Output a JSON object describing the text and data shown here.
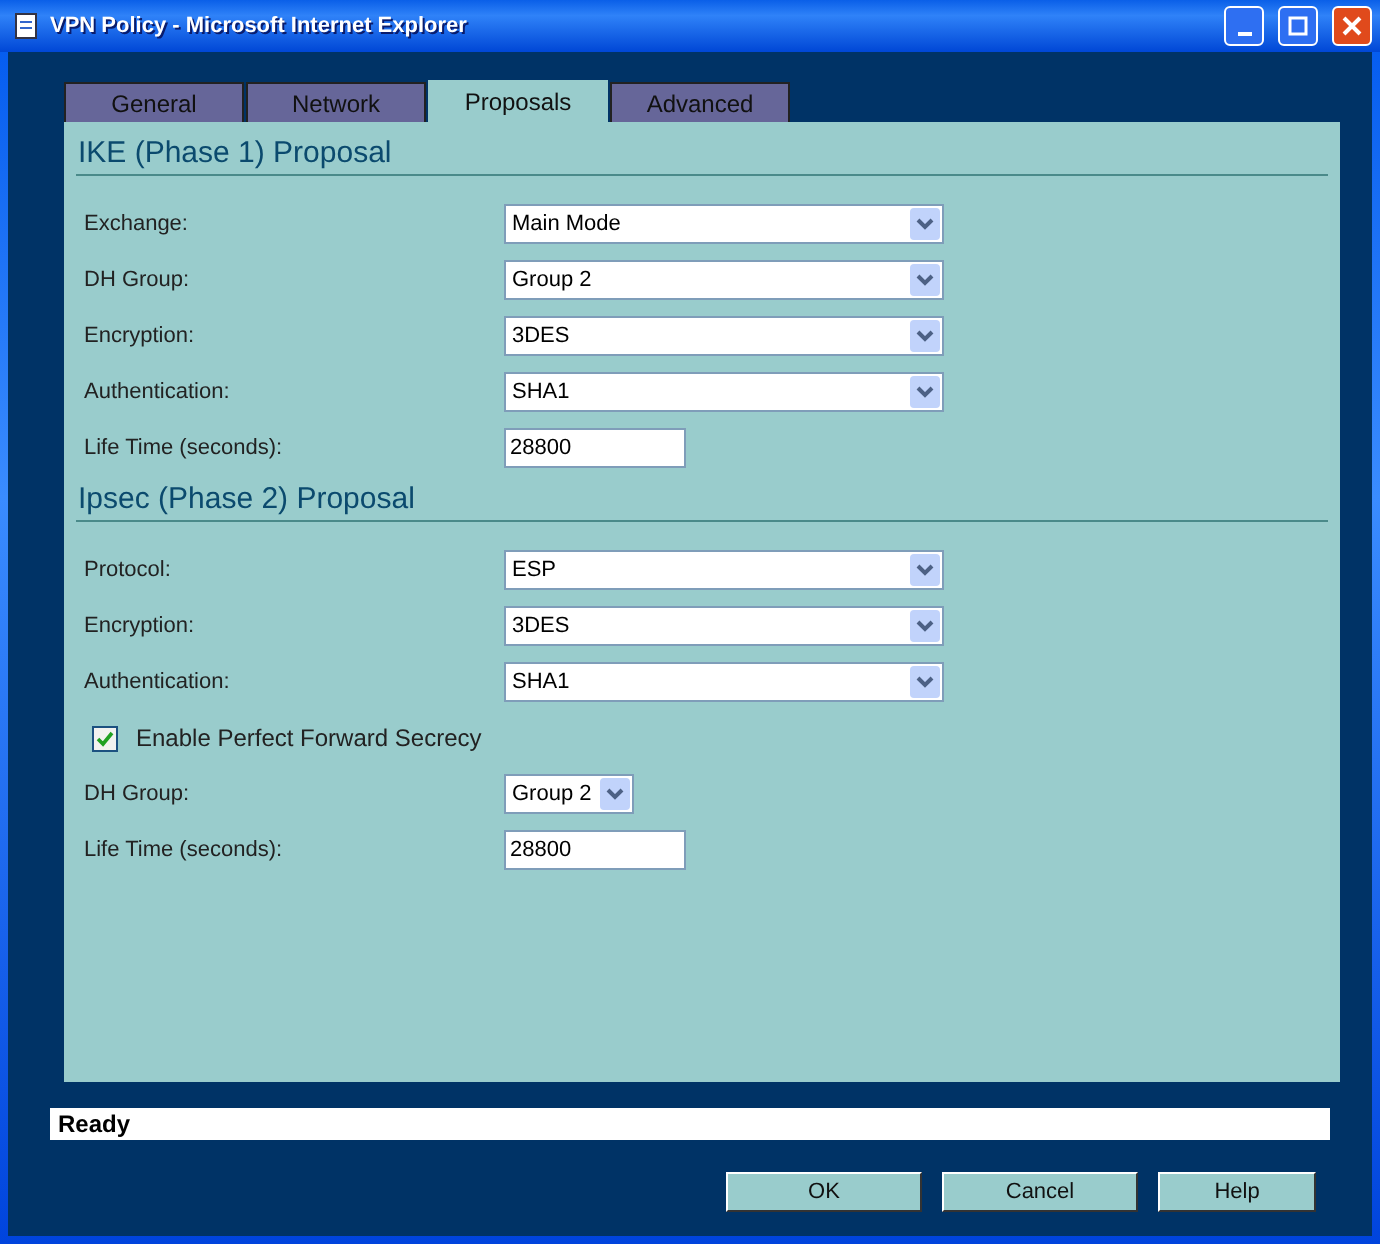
{
  "window": {
    "title": "VPN Policy - Microsoft Internet Explorer"
  },
  "tabs": [
    {
      "label": "General",
      "selected": false
    },
    {
      "label": "Network",
      "selected": false
    },
    {
      "label": "Proposals",
      "selected": true
    },
    {
      "label": "Advanced",
      "selected": false
    }
  ],
  "sections": [
    {
      "title": "IKE (Phase 1) Proposal",
      "rows": [
        {
          "kind": "select",
          "label": "Exchange:",
          "value": "Main Mode"
        },
        {
          "kind": "select",
          "label": "DH Group:",
          "value": "Group 2"
        },
        {
          "kind": "select",
          "label": "Encryption:",
          "value": "3DES"
        },
        {
          "kind": "select",
          "label": "Authentication:",
          "value": "SHA1"
        },
        {
          "kind": "text",
          "label": "Life Time (seconds):",
          "value": "28800"
        }
      ]
    },
    {
      "title": "Ipsec (Phase 2) Proposal",
      "rows": [
        {
          "kind": "select",
          "label": "Protocol:",
          "value": "ESP"
        },
        {
          "kind": "select",
          "label": "Encryption:",
          "value": "3DES"
        },
        {
          "kind": "select",
          "label": "Authentication:",
          "value": "SHA1"
        },
        {
          "kind": "checkbox",
          "label": "Enable Perfect Forward Secrecy",
          "checked": true
        },
        {
          "kind": "small-select",
          "label": "DH Group:",
          "value": "Group 2"
        },
        {
          "kind": "text",
          "label": "Life Time (seconds):",
          "value": "28800"
        }
      ]
    }
  ],
  "status_bar": "Ready",
  "buttons": [
    "OK",
    "Cancel",
    "Help"
  ]
}
